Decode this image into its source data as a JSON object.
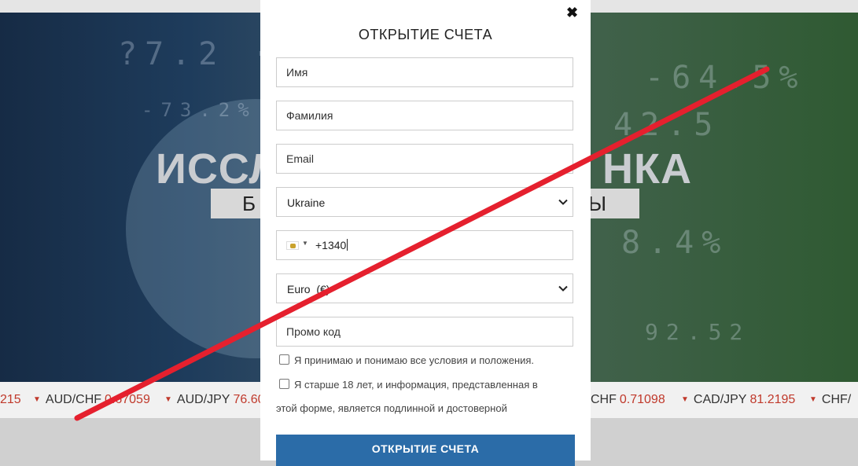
{
  "hero": {
    "title_left": "ИССЛ",
    "title_right": "НКА",
    "subtitle_left": "Б",
    "subtitle_right": "Ы"
  },
  "ticker": [
    {
      "symbol": "",
      "value": "215"
    },
    {
      "symbol": "AUD/CHF",
      "value": "0.67059"
    },
    {
      "symbol": "AUD/JPY",
      "value": "76.60"
    },
    {
      "symbol": "CHF",
      "value": "0.71098"
    },
    {
      "symbol": "CAD/JPY",
      "value": "81.2195"
    },
    {
      "symbol": "CHF/",
      "value": ""
    }
  ],
  "modal": {
    "close_icon": "close-icon",
    "title": "ОТКРЫТИЕ СЧЕТА",
    "first_name_placeholder": "Имя",
    "last_name_placeholder": "Фамилия",
    "email_placeholder": "Email",
    "country_selected": "Ukraine",
    "phone_value": "+1340",
    "currency_selected": "Euro  (€)",
    "promo_placeholder": "Промо код",
    "terms_label": "Я принимаю и понимаю все условия и положения.",
    "age_label_line1": "Я старше 18 лет, и информация, представленная в",
    "age_label_line2": "этой форме, является подлинной и достоверной",
    "submit_label": "ОТКРЫТИЕ СЧЕТА"
  },
  "colors": {
    "accent": "#2b6ca8",
    "ticker_value": "#c0392b",
    "overlay_line": "#e5202e"
  }
}
